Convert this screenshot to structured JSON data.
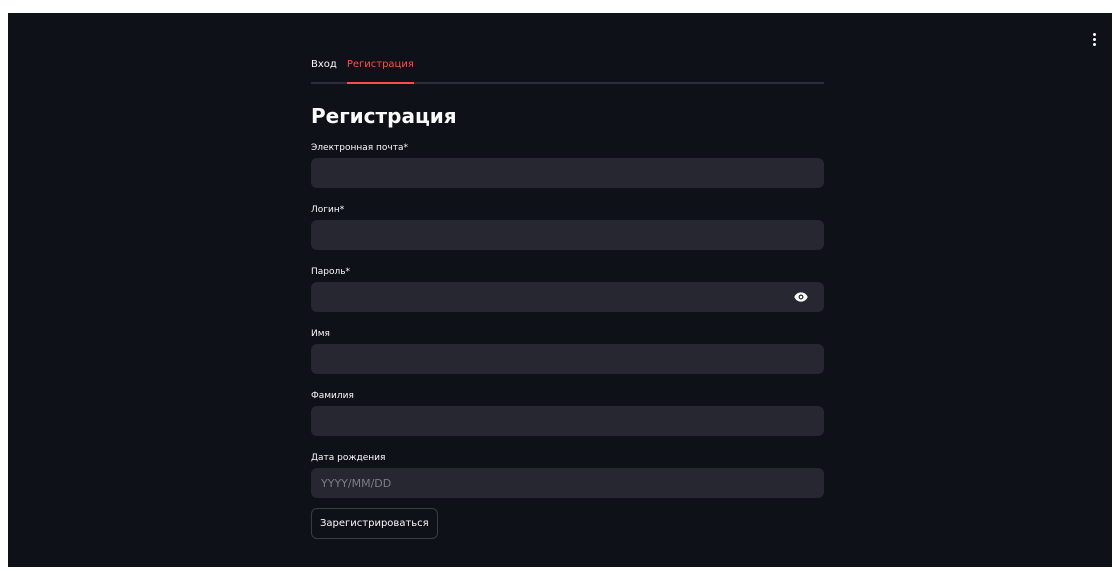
{
  "tabs": [
    {
      "label": "Вход",
      "active": false
    },
    {
      "label": "Регистрация",
      "active": true
    }
  ],
  "page_title": "Регистрация",
  "fields": {
    "email": {
      "label": "Электронная почта*",
      "value": "",
      "placeholder": ""
    },
    "login": {
      "label": "Логин*",
      "value": "",
      "placeholder": ""
    },
    "password": {
      "label": "Пароль*",
      "value": "",
      "placeholder": "",
      "icon": "eye-icon"
    },
    "first_name": {
      "label": "Имя",
      "value": "",
      "placeholder": ""
    },
    "last_name": {
      "label": "Фамилия",
      "value": "",
      "placeholder": ""
    },
    "birth_date": {
      "label": "Дата рождения",
      "value": "",
      "placeholder": "YYYY/MM/DD"
    }
  },
  "submit_label": "Зарегистрироваться",
  "menu_icon": "kebab-menu-icon",
  "colors": {
    "background": "#0e1117",
    "input_bg": "#262730",
    "accent": "#ff4b4b",
    "text": "#fafafa"
  }
}
